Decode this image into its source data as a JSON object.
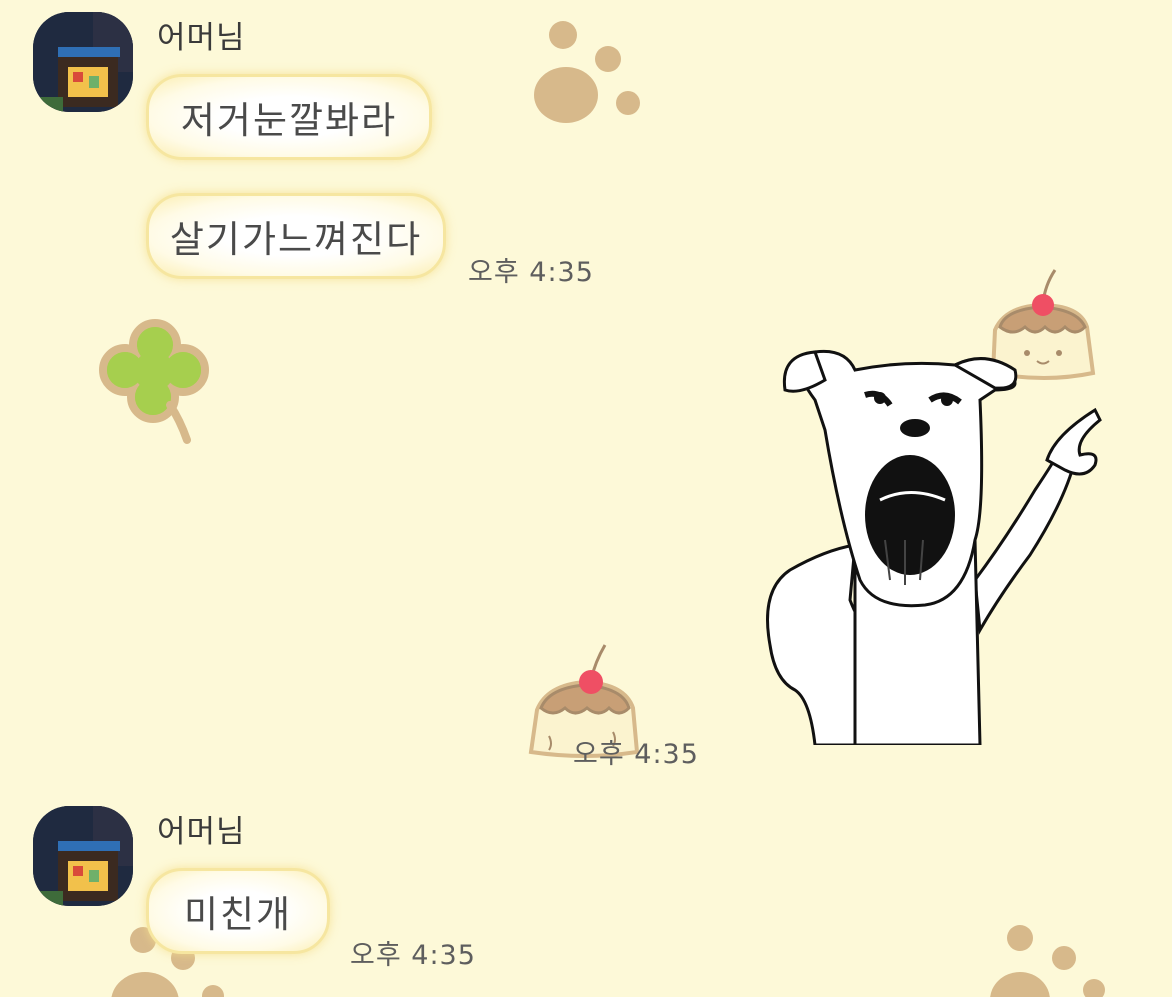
{
  "messages": [
    {
      "sender": "어머님",
      "bubbles": [
        "저거눈깔봐라",
        "살기가느껴진다"
      ],
      "time": "오후 4:35"
    },
    {
      "sender": "",
      "sticker": "dog-pointing-sticker",
      "time": "오후 4:35"
    },
    {
      "sender": "어머님",
      "bubbles": [
        "미친개"
      ],
      "time": "오후 4:35"
    }
  ],
  "colors": {
    "background": "#fdf9d8",
    "bubble_border": "#f6e6a0",
    "paw": "#d7b98b",
    "clover": "#a6cf4e",
    "cherry": "#ef4f64"
  }
}
